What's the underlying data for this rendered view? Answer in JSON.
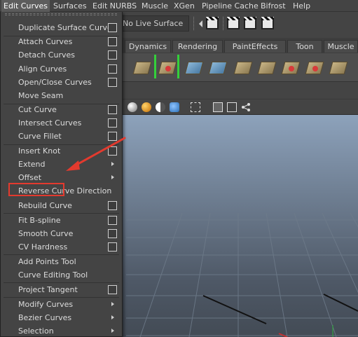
{
  "menubar": {
    "items": [
      {
        "label": "Edit Curves"
      },
      {
        "label": "Surfaces"
      },
      {
        "label": "Edit NURBS"
      },
      {
        "label": "Muscle"
      },
      {
        "label": "XGen"
      },
      {
        "label": "Pipeline Cache"
      },
      {
        "label": "Bifrost"
      },
      {
        "label": "Help"
      }
    ]
  },
  "statusline": {
    "live_surface": "No Live Surface"
  },
  "shelf_tabs": [
    {
      "label": "Dynamics"
    },
    {
      "label": "Rendering"
    },
    {
      "label": "PaintEffects"
    },
    {
      "label": "Toon"
    },
    {
      "label": "Muscle"
    }
  ],
  "menu": {
    "items": [
      {
        "label": "Duplicate Surface Curves",
        "option_box": true
      },
      {
        "label": "Attach Curves",
        "option_box": true
      },
      {
        "label": "Detach Curves",
        "option_box": true
      },
      {
        "label": "Align Curves",
        "option_box": true
      },
      {
        "label": "Open/Close Curves",
        "option_box": true
      },
      {
        "label": "Move Seam",
        "option_box": false
      },
      {
        "label": "Cut Curve",
        "option_box": true
      },
      {
        "label": "Intersect Curves",
        "option_box": true
      },
      {
        "label": "Curve Fillet",
        "option_box": true
      },
      {
        "label": "Insert Knot",
        "option_box": true
      },
      {
        "label": "Extend",
        "submenu": true
      },
      {
        "label": "Offset",
        "submenu": true,
        "highlighted": true
      },
      {
        "label": "Reverse Curve Direction",
        "option_box": true
      },
      {
        "label": "Rebuild Curve",
        "option_box": true
      },
      {
        "label": "Fit B-spline",
        "option_box": true
      },
      {
        "label": "Smooth Curve",
        "option_box": true
      },
      {
        "label": "CV Hardness",
        "option_box": true
      },
      {
        "label": "Add Points Tool",
        "option_box": false
      },
      {
        "label": "Curve Editing Tool",
        "option_box": false
      },
      {
        "label": "Project Tangent",
        "option_box": true
      },
      {
        "label": "Modify Curves",
        "submenu": true
      },
      {
        "label": "Bezier Curves",
        "submenu": true
      },
      {
        "label": "Selection",
        "submenu": true
      }
    ]
  },
  "colors": {
    "annotation_red": "#e33a2e",
    "selection_green": "#34d03a",
    "menu_bg": "#444444"
  }
}
